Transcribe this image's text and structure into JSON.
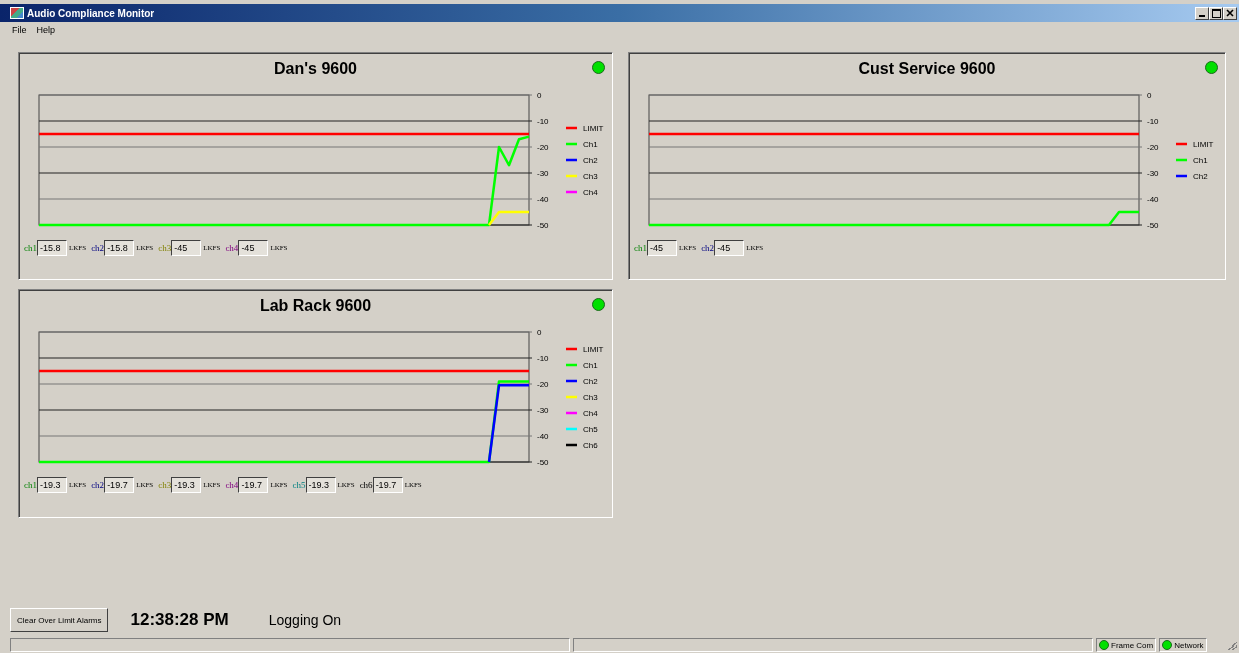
{
  "window": {
    "title": "Audio Compliance Monitor"
  },
  "menu": [
    "File",
    "Help"
  ],
  "panels": [
    {
      "title": "Dan's 9600",
      "alarm": false,
      "chart_data": {
        "type": "line",
        "grid": true,
        "legend": true,
        "ylim": [
          -50,
          0
        ],
        "yticks": [
          0,
          -10,
          -20,
          -30,
          -40,
          -50
        ],
        "series": [
          {
            "name": "LIMIT",
            "color": "#ff0000",
            "values": [
              -15,
              -15,
              -15,
              -15,
              -15,
              -15,
              -15,
              -15,
              -15,
              -15,
              -15,
              -15,
              -15,
              -15,
              -15,
              -15,
              -15,
              -15,
              -15,
              -15,
              -15,
              -15,
              -15,
              -15,
              -15,
              -15,
              -15,
              -15,
              -15,
              -15,
              -15,
              -15,
              -15,
              -15,
              -15,
              -15,
              -15,
              -15,
              -15,
              -15,
              -15,
              -15,
              -15,
              -15,
              -15,
              -15,
              -15,
              -15,
              -15,
              -15
            ]
          },
          {
            "name": "Ch1",
            "color": "#00ff00",
            "values": [
              -50,
              -50,
              -50,
              -50,
              -50,
              -50,
              -50,
              -50,
              -50,
              -50,
              -50,
              -50,
              -50,
              -50,
              -50,
              -50,
              -50,
              -50,
              -50,
              -50,
              -50,
              -50,
              -50,
              -50,
              -50,
              -50,
              -50,
              -50,
              -50,
              -50,
              -50,
              -50,
              -50,
              -50,
              -50,
              -50,
              -50,
              -50,
              -50,
              -50,
              -50,
              -50,
              -50,
              -50,
              -50,
              -50,
              -20,
              -27,
              -17,
              -16
            ]
          },
          {
            "name": "Ch2",
            "color": "#0000ff",
            "values": [
              null,
              null,
              null,
              null,
              null,
              null,
              null,
              null,
              null,
              null,
              null,
              null,
              null,
              null,
              null,
              null,
              null,
              null,
              null,
              null,
              null,
              null,
              null,
              null,
              null,
              null,
              null,
              null,
              null,
              null,
              null,
              null,
              null,
              null,
              null,
              null,
              null,
              null,
              null,
              null,
              null,
              null,
              null,
              null,
              null,
              null,
              null,
              null,
              null,
              null
            ]
          },
          {
            "name": "Ch3",
            "color": "#ffff00",
            "values": [
              null,
              null,
              null,
              null,
              null,
              null,
              null,
              null,
              null,
              null,
              null,
              null,
              null,
              null,
              null,
              null,
              null,
              null,
              null,
              null,
              null,
              null,
              null,
              null,
              null,
              null,
              null,
              null,
              null,
              null,
              null,
              null,
              null,
              null,
              null,
              null,
              null,
              null,
              null,
              null,
              null,
              null,
              null,
              null,
              null,
              -50,
              -45,
              -45,
              -45,
              -45
            ]
          },
          {
            "name": "Ch4",
            "color": "#ff00ff",
            "values": [
              null,
              null,
              null,
              null,
              null,
              null,
              null,
              null,
              null,
              null,
              null,
              null,
              null,
              null,
              null,
              null,
              null,
              null,
              null,
              null,
              null,
              null,
              null,
              null,
              null,
              null,
              null,
              null,
              null,
              null,
              null,
              null,
              null,
              null,
              null,
              null,
              null,
              null,
              null,
              null,
              null,
              null,
              null,
              null,
              null,
              null,
              null,
              null,
              null,
              null
            ]
          }
        ]
      },
      "readouts": [
        {
          "label": "ch1",
          "value": "-15.8",
          "unit": "LKFS"
        },
        {
          "label": "ch2",
          "value": "-15.8",
          "unit": "LKFS"
        },
        {
          "label": "ch3",
          "value": "-45",
          "unit": "LKFS"
        },
        {
          "label": "ch4",
          "value": "-45",
          "unit": "LKFS"
        }
      ]
    },
    {
      "title": "Cust Service 9600",
      "alarm": false,
      "chart_data": {
        "type": "line",
        "grid": true,
        "legend": true,
        "ylim": [
          -50,
          0
        ],
        "yticks": [
          0,
          -10,
          -20,
          -30,
          -40,
          -50
        ],
        "series": [
          {
            "name": "LIMIT",
            "color": "#ff0000",
            "values": [
              -15,
              -15,
              -15,
              -15,
              -15,
              -15,
              -15,
              -15,
              -15,
              -15,
              -15,
              -15,
              -15,
              -15,
              -15,
              -15,
              -15,
              -15,
              -15,
              -15,
              -15,
              -15,
              -15,
              -15,
              -15,
              -15,
              -15,
              -15,
              -15,
              -15,
              -15,
              -15,
              -15,
              -15,
              -15,
              -15,
              -15,
              -15,
              -15,
              -15,
              -15,
              -15,
              -15,
              -15,
              -15,
              -15,
              -15,
              -15,
              -15,
              -15
            ]
          },
          {
            "name": "Ch1",
            "color": "#00ff00",
            "values": [
              -50,
              -50,
              -50,
              -50,
              -50,
              -50,
              -50,
              -50,
              -50,
              -50,
              -50,
              -50,
              -50,
              -50,
              -50,
              -50,
              -50,
              -50,
              -50,
              -50,
              -50,
              -50,
              -50,
              -50,
              -50,
              -50,
              -50,
              -50,
              -50,
              -50,
              -50,
              -50,
              -50,
              -50,
              -50,
              -50,
              -50,
              -50,
              -50,
              -50,
              -50,
              -50,
              -50,
              -50,
              -50,
              -50,
              -50,
              -45,
              -45,
              -45
            ]
          },
          {
            "name": "Ch2",
            "color": "#0000ff",
            "values": [
              null,
              null,
              null,
              null,
              null,
              null,
              null,
              null,
              null,
              null,
              null,
              null,
              null,
              null,
              null,
              null,
              null,
              null,
              null,
              null,
              null,
              null,
              null,
              null,
              null,
              null,
              null,
              null,
              null,
              null,
              null,
              null,
              null,
              null,
              null,
              null,
              null,
              null,
              null,
              null,
              null,
              null,
              null,
              null,
              null,
              null,
              null,
              null,
              null,
              null
            ]
          }
        ]
      },
      "readouts": [
        {
          "label": "ch1",
          "value": "-45",
          "unit": "LKFS"
        },
        {
          "label": "ch2",
          "value": "-45",
          "unit": "LKFS"
        }
      ]
    },
    {
      "title": "Lab Rack 9600",
      "alarm": false,
      "chart_data": {
        "type": "line",
        "grid": true,
        "legend": true,
        "ylim": [
          -50,
          0
        ],
        "yticks": [
          0,
          -10,
          -20,
          -30,
          -40,
          -50
        ],
        "series": [
          {
            "name": "LIMIT",
            "color": "#ff0000",
            "values": [
              -15,
              -15,
              -15,
              -15,
              -15,
              -15,
              -15,
              -15,
              -15,
              -15,
              -15,
              -15,
              -15,
              -15,
              -15,
              -15,
              -15,
              -15,
              -15,
              -15,
              -15,
              -15,
              -15,
              -15,
              -15,
              -15,
              -15,
              -15,
              -15,
              -15,
              -15,
              -15,
              -15,
              -15,
              -15,
              -15,
              -15,
              -15,
              -15,
              -15,
              -15,
              -15,
              -15,
              -15,
              -15,
              -15,
              -15,
              -15,
              -15,
              -15
            ]
          },
          {
            "name": "Ch1",
            "color": "#00ff00",
            "values": [
              -50,
              -50,
              -50,
              -50,
              -50,
              -50,
              -50,
              -50,
              -50,
              -50,
              -50,
              -50,
              -50,
              -50,
              -50,
              -50,
              -50,
              -50,
              -50,
              -50,
              -50,
              -50,
              -50,
              -50,
              -50,
              -50,
              -50,
              -50,
              -50,
              -50,
              -50,
              -50,
              -50,
              -50,
              -50,
              -50,
              -50,
              -50,
              -50,
              -50,
              -50,
              -50,
              -50,
              -50,
              -50,
              -50,
              -19,
              -19,
              -19,
              -19
            ]
          },
          {
            "name": "Ch2",
            "color": "#0000ff",
            "values": [
              null,
              null,
              null,
              null,
              null,
              null,
              null,
              null,
              null,
              null,
              null,
              null,
              null,
              null,
              null,
              null,
              null,
              null,
              null,
              null,
              null,
              null,
              null,
              null,
              null,
              null,
              null,
              null,
              null,
              null,
              null,
              null,
              null,
              null,
              null,
              null,
              null,
              null,
              null,
              null,
              null,
              null,
              null,
              null,
              null,
              -50,
              -20.5,
              -20.5,
              -20.5,
              -20.5
            ]
          },
          {
            "name": "Ch3",
            "color": "#ffff00",
            "values": [
              null,
              null,
              null,
              null,
              null,
              null,
              null,
              null,
              null,
              null,
              null,
              null,
              null,
              null,
              null,
              null,
              null,
              null,
              null,
              null,
              null,
              null,
              null,
              null,
              null,
              null,
              null,
              null,
              null,
              null,
              null,
              null,
              null,
              null,
              null,
              null,
              null,
              null,
              null,
              null,
              null,
              null,
              null,
              null,
              null,
              null,
              null,
              null,
              null,
              null
            ]
          },
          {
            "name": "Ch4",
            "color": "#ff00ff",
            "values": [
              null,
              null,
              null,
              null,
              null,
              null,
              null,
              null,
              null,
              null,
              null,
              null,
              null,
              null,
              null,
              null,
              null,
              null,
              null,
              null,
              null,
              null,
              null,
              null,
              null,
              null,
              null,
              null,
              null,
              null,
              null,
              null,
              null,
              null,
              null,
              null,
              null,
              null,
              null,
              null,
              null,
              null,
              null,
              null,
              null,
              null,
              null,
              null,
              null,
              null
            ]
          },
          {
            "name": "Ch5",
            "color": "#00ffff",
            "values": [
              null,
              null,
              null,
              null,
              null,
              null,
              null,
              null,
              null,
              null,
              null,
              null,
              null,
              null,
              null,
              null,
              null,
              null,
              null,
              null,
              null,
              null,
              null,
              null,
              null,
              null,
              null,
              null,
              null,
              null,
              null,
              null,
              null,
              null,
              null,
              null,
              null,
              null,
              null,
              null,
              null,
              null,
              null,
              null,
              null,
              null,
              null,
              null,
              null,
              null
            ]
          },
          {
            "name": "Ch6",
            "color": "#000000",
            "values": [
              null,
              null,
              null,
              null,
              null,
              null,
              null,
              null,
              null,
              null,
              null,
              null,
              null,
              null,
              null,
              null,
              null,
              null,
              null,
              null,
              null,
              null,
              null,
              null,
              null,
              null,
              null,
              null,
              null,
              null,
              null,
              null,
              null,
              null,
              null,
              null,
              null,
              null,
              null,
              null,
              null,
              null,
              null,
              null,
              null,
              null,
              null,
              null,
              null,
              null
            ]
          }
        ]
      },
      "readouts": [
        {
          "label": "ch1",
          "value": "-19.3",
          "unit": "LKFS"
        },
        {
          "label": "ch2",
          "value": "-19.7",
          "unit": "LKFS"
        },
        {
          "label": "ch3",
          "value": "-19.3",
          "unit": "LKFS"
        },
        {
          "label": "ch4",
          "value": "-19.7",
          "unit": "LKFS"
        },
        {
          "label": "ch5",
          "value": "-19.3",
          "unit": "LKFS"
        },
        {
          "label": "ch6",
          "value": "-19.7",
          "unit": "LKFS"
        }
      ]
    }
  ],
  "clear_button": "Clear Over Limit Alarms",
  "clock": "12:38:28 PM",
  "logging": "Logging On",
  "indicators": [
    {
      "label": "Frame Com",
      "on": true
    },
    {
      "label": "Network",
      "on": true
    }
  ]
}
